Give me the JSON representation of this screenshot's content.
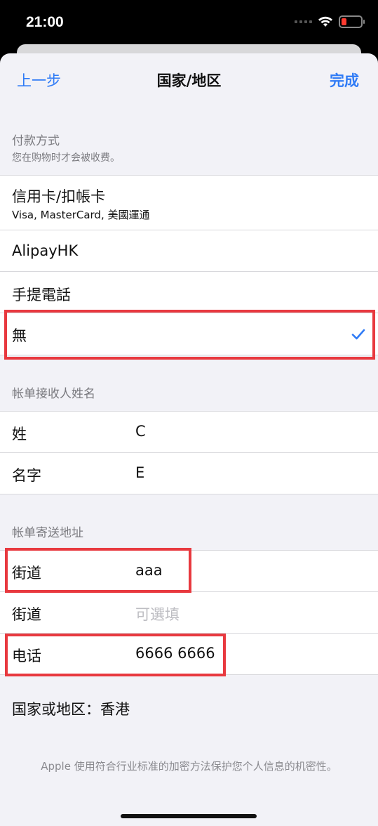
{
  "status_bar": {
    "time": "21:00"
  },
  "nav": {
    "back": "上一步",
    "title": "国家/地区",
    "done": "完成"
  },
  "payment": {
    "header": "付款方式",
    "subheader": "您在购物时才会被收费。",
    "options": [
      {
        "label": "信用卡/扣帳卡",
        "sub": "Visa, MasterCard, 美國運通"
      },
      {
        "label": "AlipayHK"
      },
      {
        "label": "手提電話"
      },
      {
        "label": "無",
        "selected": true
      }
    ]
  },
  "billing_name": {
    "header": "帐单接收人姓名",
    "rows": [
      {
        "label": "姓",
        "value": "C"
      },
      {
        "label": "名字",
        "value": "E"
      }
    ]
  },
  "billing_address": {
    "header": "帐单寄送地址",
    "street1": {
      "label": "街道",
      "value": "aaa"
    },
    "street2": {
      "label": "街道",
      "placeholder": "可選填"
    },
    "phone": {
      "label": "电话",
      "value": "6666 6666"
    }
  },
  "country": {
    "label": "国家或地区：",
    "value": "香港"
  },
  "footer": "Apple 使用符合行业标准的加密方法保护您个人信息的机密性。",
  "colors": {
    "accent": "#2f7bf6",
    "highlight": "#e8393f",
    "background": "#f2f2f7"
  },
  "icons": [
    "wifi-icon",
    "battery-icon",
    "checkmark-icon"
  ]
}
